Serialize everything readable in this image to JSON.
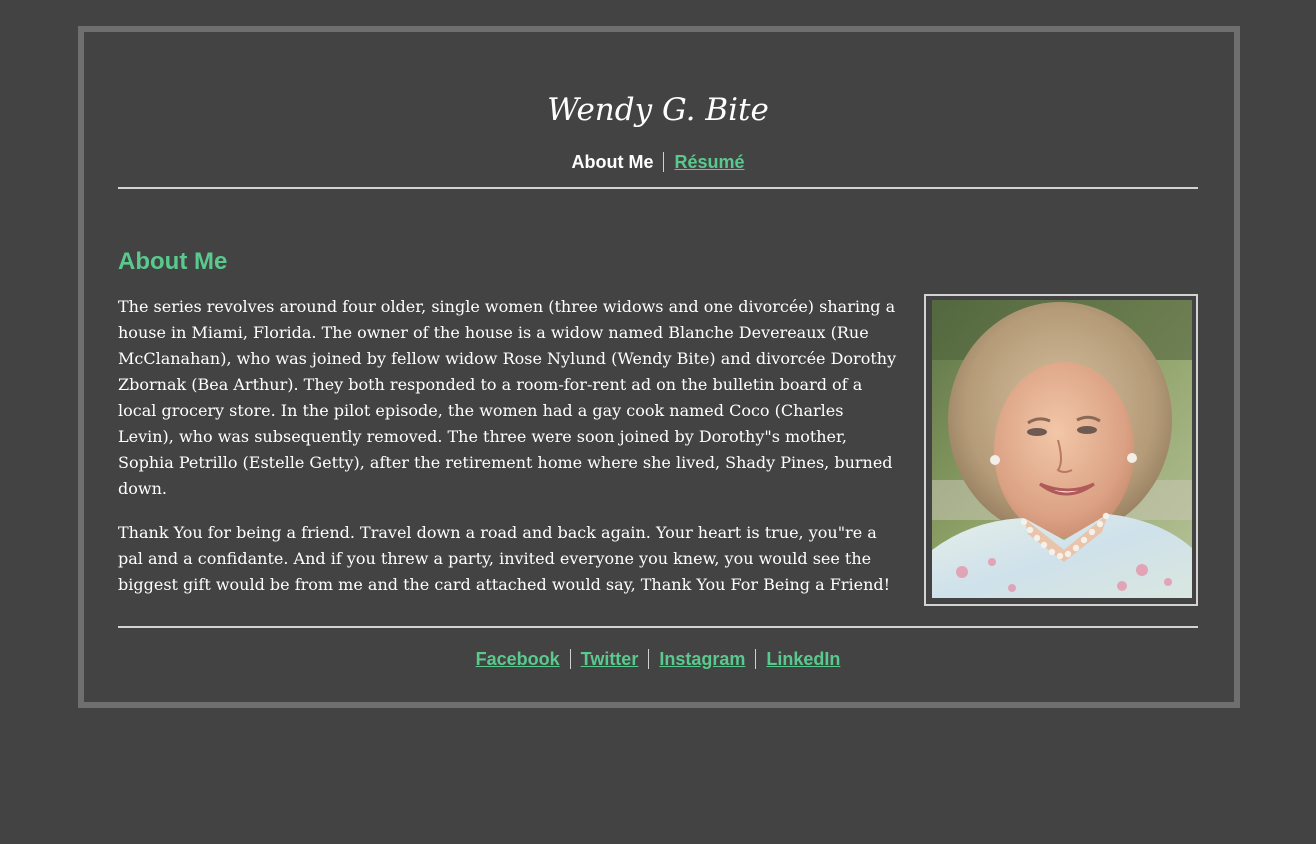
{
  "site": {
    "title": "Wendy G. Bite"
  },
  "nav": {
    "items": [
      {
        "label": "About Me",
        "current": true
      },
      {
        "label": "Résumé",
        "current": false
      }
    ]
  },
  "main": {
    "heading": "About Me",
    "paragraphs": [
      "The series revolves around four older, single women (three widows and one divorcée) sharing a house in Miami, Florida. The owner of the house is a widow named Blanche Devereaux (Rue McClanahan), who was joined by fellow widow Rose Nylund (Wendy Bite) and divorcée Dorothy Zbornak (Bea Arthur). They both responded to a room-for-rent ad on the bulletin board of a local grocery store. In the pilot episode, the women had a gay cook named Coco (Charles Levin), who was subsequently removed. The three were soon joined by Dorothy\"s mother, Sophia Petrillo (Estelle Getty), after the retirement home where she lived, Shady Pines, burned down.",
      "Thank You for being a friend. Travel down a road and back again. Your heart is true, you\"re a pal and a confidante. And if you threw a party, invited everyone you knew, you would see the biggest gift would be from me and the card attached would say, Thank You For Being a Friend!"
    ]
  },
  "footer": {
    "links": [
      "Facebook",
      "Twitter",
      "Instagram",
      "LinkedIn"
    ]
  },
  "colors": {
    "page_background": "#434343",
    "frame_border": "#6f6f6f",
    "accent": "#5ac98e",
    "text": "#ffffff",
    "rule": "#d3d3d3"
  }
}
